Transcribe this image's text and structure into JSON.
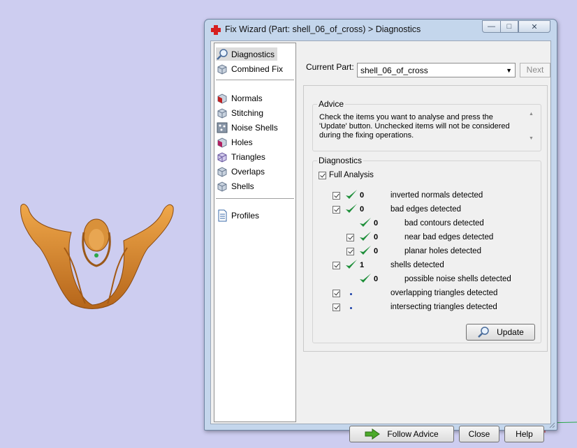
{
  "window": {
    "title": "Fix Wizard (Part: shell_06_of_cross) > Diagnostics"
  },
  "nav": {
    "items": [
      {
        "label": "Diagnostics",
        "icon": "magnifier-icon"
      },
      {
        "label": "Combined Fix",
        "icon": "cube-stack-icon"
      },
      {
        "label": "Normals",
        "icon": "cube-normals-icon"
      },
      {
        "label": "Stitching",
        "icon": "cube-stitch-icon"
      },
      {
        "label": "Noise Shells",
        "icon": "noise-shells-icon"
      },
      {
        "label": "Holes",
        "icon": "cube-holes-icon"
      },
      {
        "label": "Triangles",
        "icon": "cube-triangles-icon"
      },
      {
        "label": "Overlaps",
        "icon": "cube-overlaps-icon"
      },
      {
        "label": "Shells",
        "icon": "cube-shells-icon"
      },
      {
        "label": "Profiles",
        "icon": "document-icon"
      }
    ],
    "selected": "Diagnostics"
  },
  "current_part": {
    "label": "Current Part:",
    "value": "shell_06_of_cross"
  },
  "next_label": "Next",
  "advice": {
    "title": "Advice",
    "text": "Check the items you want to analyse and press the 'Update' button. Unchecked items will not be considered during the fixing operations."
  },
  "diagnostics": {
    "title": "Diagnostics",
    "full_analysis": "Full Analysis",
    "rows": [
      {
        "count": "0",
        "label": "inverted normals detected",
        "status": "ok"
      },
      {
        "count": "0",
        "label": "bad edges detected",
        "status": "ok"
      },
      {
        "count": "0",
        "label": "bad contours detected",
        "status": "ok"
      },
      {
        "count": "0",
        "label": "near bad edges detected",
        "status": "ok"
      },
      {
        "count": "0",
        "label": "planar holes detected",
        "status": "ok"
      },
      {
        "count": "1",
        "label": "shells detected",
        "status": "ok"
      },
      {
        "count": "0",
        "label": "possible noise shells detected",
        "status": "ok"
      },
      {
        "count": "",
        "label": "overlapping triangles detected",
        "status": "pending"
      },
      {
        "count": "",
        "label": "intersecting triangles detected",
        "status": "pending"
      }
    ],
    "update_label": "Update"
  },
  "buttons": {
    "follow_advice": "Follow Advice",
    "close": "Close",
    "help": "Help"
  },
  "colors": {
    "background": "#cdcdf0",
    "model": "#d4882a",
    "check_green": "#1e8f3a",
    "title_cross": "#d62020"
  }
}
